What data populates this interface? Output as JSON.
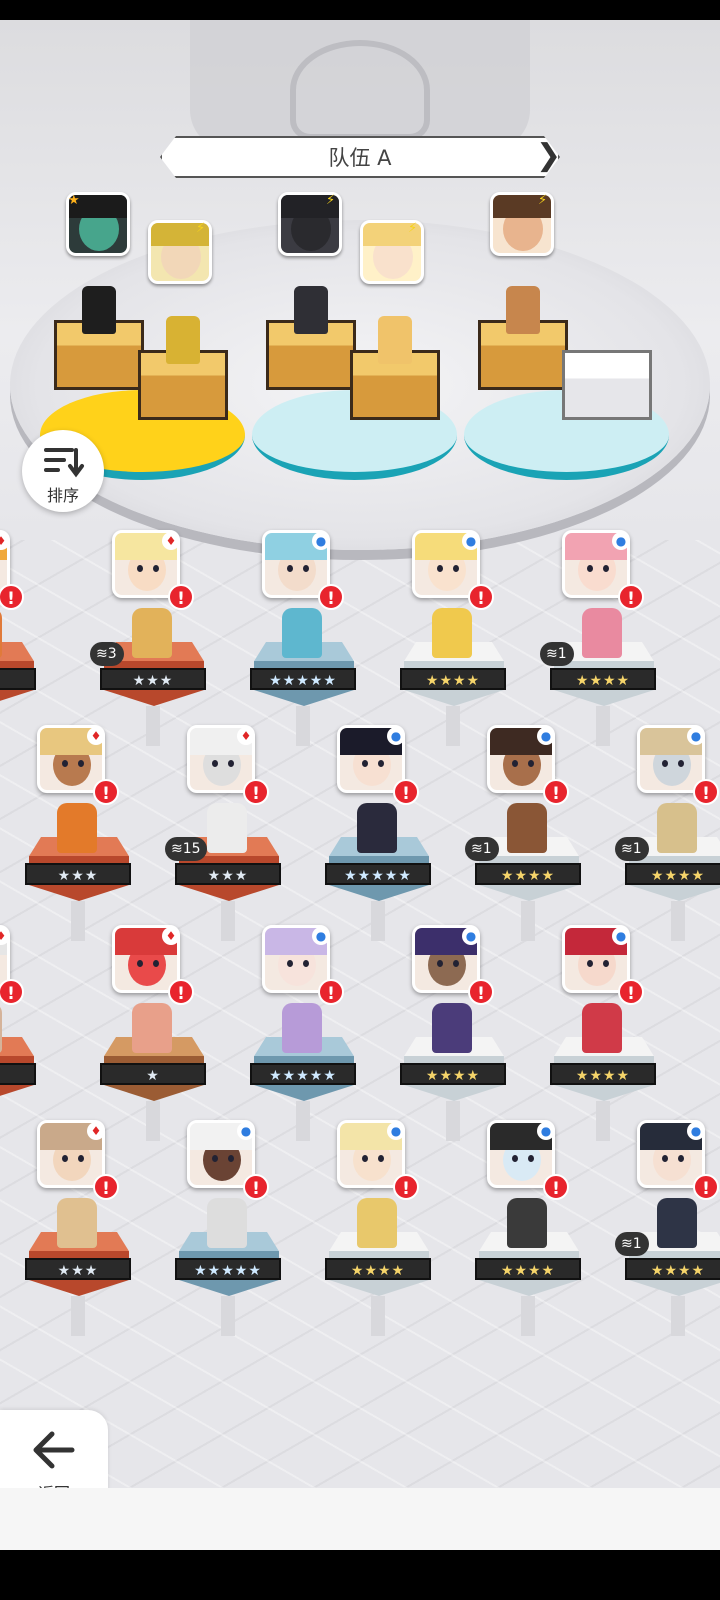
{
  "team": {
    "title": "队伍 A",
    "slots": [
      {
        "portrait_color": "#2d3b3a",
        "hair": "#1b1b1b",
        "face": "#47a58c",
        "tag": "star",
        "sprite": "#1e1e1e",
        "pedestal": "gold"
      },
      {
        "portrait_color": "#f3e6b0",
        "hair": "#d4b437",
        "face": "#f2d7b8",
        "tag": "bolt",
        "sprite": "#d8b233",
        "pedestal": "gold"
      },
      {
        "portrait_color": "#3b3b42",
        "hair": "#222226",
        "face": "#2a2a2e",
        "tag": "bolt",
        "sprite": "#2f2f35",
        "pedestal": "gold"
      },
      {
        "portrait_color": "#fff1c8",
        "hair": "#f3d279",
        "face": "#f9e1cc",
        "tag": "bolt",
        "sprite": "#f0c36a",
        "pedestal": "gold"
      },
      {
        "portrait_color": "#f7e4cf",
        "hair": "#5a3a24",
        "face": "#e8b48e",
        "tag": "bolt",
        "sprite": "#c7864d",
        "pedestal": "gold"
      },
      {
        "portrait_color": null,
        "hair": null,
        "face": null,
        "tag": null,
        "sprite": null,
        "pedestal": "empty"
      }
    ]
  },
  "sort": {
    "label": "排序"
  },
  "back": {
    "label": "返回"
  },
  "roster": [
    {
      "row": 0,
      "col": -1,
      "element": "fire",
      "stars": "★★",
      "star_style": "silver",
      "dup": null,
      "pedestal": "red",
      "hair": "#f0a83a",
      "face": "#f3d0b0",
      "sprite": "#e07a3a"
    },
    {
      "row": 0,
      "col": 0,
      "element": "fire",
      "stars": "★★★",
      "star_style": "silver",
      "dup": "3",
      "pedestal": "red",
      "hair": "#f6e6a0",
      "face": "#f8dcc4",
      "sprite": "#e2b25a"
    },
    {
      "row": 0,
      "col": 1,
      "element": "water",
      "stars": "★★★★★",
      "star_style": "rainbow",
      "dup": null,
      "pedestal": "blue",
      "hair": "#8fd0e2",
      "face": "#f3dccb",
      "sprite": "#5eb7cf"
    },
    {
      "row": 0,
      "col": 2,
      "element": "water",
      "stars": "★★★★",
      "star_style": "gold",
      "dup": null,
      "pedestal": "white",
      "hair": "#f6dc7a",
      "face": "#f9e2ce",
      "sprite": "#f0c94d"
    },
    {
      "row": 0,
      "col": 3,
      "element": "water",
      "stars": "★★★★",
      "star_style": "gold",
      "dup": "1",
      "pedestal": "white",
      "hair": "#f2a3b2",
      "face": "#f9dccf",
      "sprite": "#e98aa0"
    },
    {
      "row": 1,
      "col": 0,
      "element": "fire",
      "stars": "★★★",
      "star_style": "silver",
      "dup": null,
      "pedestal": "red",
      "hair": "#e8c77f",
      "face": "#b87a4f",
      "sprite": "#e37a2a"
    },
    {
      "row": 1,
      "col": 1,
      "element": "fire",
      "stars": "★★★",
      "star_style": "silver",
      "dup": "15",
      "pedestal": "red",
      "hair": "#f0f0f0",
      "face": "#dedede",
      "sprite": "#ececec"
    },
    {
      "row": 1,
      "col": 2,
      "element": "water",
      "stars": "★★★★★",
      "star_style": "rainbow",
      "dup": null,
      "pedestal": "blue",
      "hair": "#1b1b2a",
      "face": "#f7e0d2",
      "sprite": "#2a2a3c"
    },
    {
      "row": 1,
      "col": 3,
      "element": "water",
      "stars": "★★★★",
      "star_style": "gold",
      "dup": "1",
      "pedestal": "white",
      "hair": "#3e2a22",
      "face": "#a86f4b",
      "sprite": "#8a5636"
    },
    {
      "row": 1,
      "col": 4,
      "element": "water",
      "stars": "★★★★",
      "star_style": "gold",
      "dup": "1",
      "pedestal": "white",
      "hair": "#d9c49a",
      "face": "#cfd6dc",
      "sprite": "#d7c08c"
    },
    {
      "row": 2,
      "col": -1,
      "element": "fire",
      "stars": "★★",
      "star_style": "silver",
      "dup": null,
      "pedestal": "red",
      "hair": "#e6e6e6",
      "face": "#8a5e44",
      "sprite": "#d5b39a"
    },
    {
      "row": 2,
      "col": 0,
      "element": "fire",
      "stars": "★",
      "star_style": "silver",
      "dup": null,
      "pedestal": "brown",
      "hair": "#d93a3a",
      "face": "#e94a4a",
      "sprite": "#e8a08a"
    },
    {
      "row": 2,
      "col": 1,
      "element": "water",
      "stars": "★★★★★",
      "star_style": "rainbow",
      "dup": null,
      "pedestal": "blue",
      "hair": "#c9b7e6",
      "face": "#f7e3dc",
      "sprite": "#b79bd8"
    },
    {
      "row": 2,
      "col": 2,
      "element": "water",
      "stars": "★★★★",
      "star_style": "gold",
      "dup": null,
      "pedestal": "white",
      "hair": "#3c2f6b",
      "face": "#8d6a52",
      "sprite": "#4b3c7a"
    },
    {
      "row": 2,
      "col": 3,
      "element": "water",
      "stars": "★★★★",
      "star_style": "gold",
      "dup": null,
      "pedestal": "white",
      "hair": "#c4283a",
      "face": "#f6d9cc",
      "sprite": "#d03a48"
    },
    {
      "row": 3,
      "col": 0,
      "element": "fire",
      "stars": "★★★",
      "star_style": "silver",
      "dup": null,
      "pedestal": "red",
      "hair": "#c9a98a",
      "face": "#f2d6bd",
      "sprite": "#e0c090"
    },
    {
      "row": 3,
      "col": 1,
      "element": "water",
      "stars": "★★★★★",
      "star_style": "rainbow",
      "dup": null,
      "pedestal": "blue",
      "hair": "#f2f2f2",
      "face": "#6a4334",
      "sprite": "#ddd"
    },
    {
      "row": 3,
      "col": 2,
      "element": "water",
      "stars": "★★★★",
      "star_style": "gold",
      "dup": null,
      "pedestal": "white",
      "hair": "#f3e4a8",
      "face": "#f7e1cd",
      "sprite": "#e8c86b"
    },
    {
      "row": 3,
      "col": 3,
      "element": "water",
      "stars": "★★★★",
      "star_style": "gold",
      "dup": null,
      "pedestal": "white",
      "hair": "#2a2a2a",
      "face": "#d9eaf5",
      "sprite": "#3a3a3a"
    },
    {
      "row": 3,
      "col": 4,
      "element": "water",
      "stars": "★★★★",
      "star_style": "gold",
      "dup": "1",
      "pedestal": "white",
      "hair": "#262c3a",
      "face": "#f6e0d2",
      "sprite": "#2e3446"
    }
  ]
}
